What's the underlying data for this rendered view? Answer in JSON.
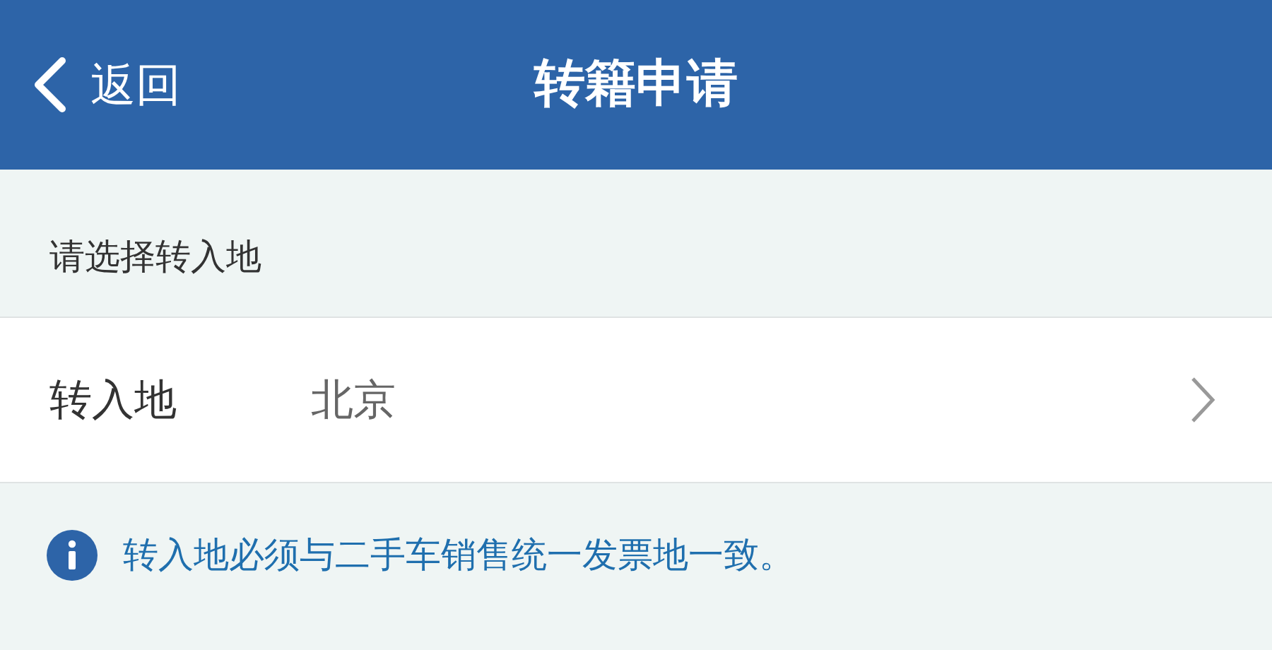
{
  "header": {
    "back": "返回",
    "title": "转籍申请"
  },
  "section_title": "请选择转入地",
  "field": {
    "label": "转入地",
    "value": "北京"
  },
  "notice": "转入地必须与二手车销售统一发票地一致。"
}
